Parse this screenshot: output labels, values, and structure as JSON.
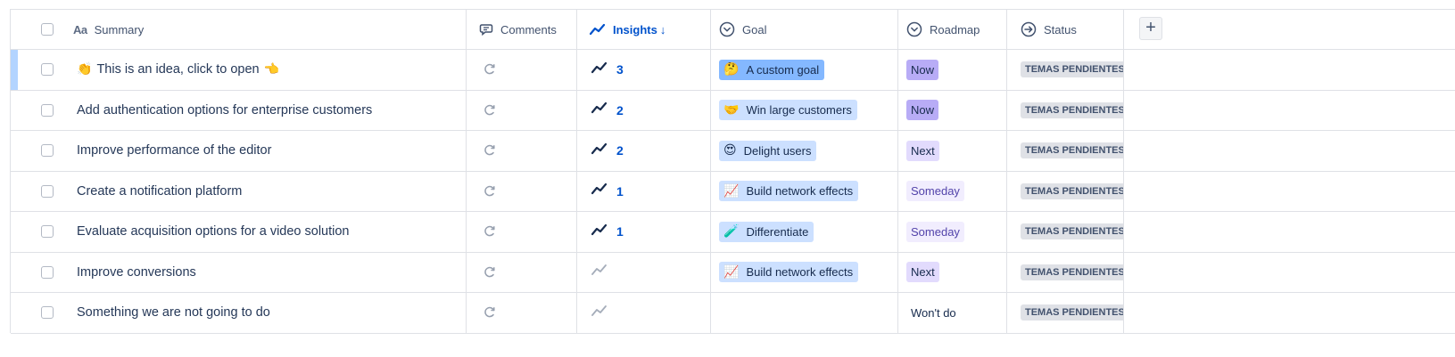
{
  "header": {
    "summary": "Summary",
    "comments": "Comments",
    "insights": "Insights",
    "goal": "Goal",
    "roadmap": "Roadmap",
    "status": "Status",
    "add_column": "+"
  },
  "roadmap_colors": {
    "Now": {
      "bg": "#b8acf6",
      "fg": "#172b4d"
    },
    "Next": {
      "bg": "#e2dbfd",
      "fg": "#172b4d"
    },
    "Someday": {
      "bg": "#f1edfe",
      "fg": "#5243aa"
    }
  },
  "rows": [
    {
      "summary": "This is an idea, click to open",
      "emoji_left": "👏",
      "emoji_right": "👈",
      "insights": "3",
      "insight_active": true,
      "goal": {
        "emoji": "🤔",
        "label": "A custom goal",
        "strong": true
      },
      "roadmap": "Now",
      "status": "TEMAS PENDIENTES",
      "highlight": true
    },
    {
      "summary": "Add authentication options for enterprise customers",
      "insights": "2",
      "insight_active": true,
      "goal": {
        "emoji": "🤝",
        "label": "Win large customers"
      },
      "roadmap": "Now",
      "status": "TEMAS PENDIENTES"
    },
    {
      "summary": "Improve performance of the editor",
      "insights": "2",
      "insight_active": true,
      "goal": {
        "emoji": "😍",
        "label": "Delight users"
      },
      "roadmap": "Next",
      "status": "TEMAS PENDIENTES"
    },
    {
      "summary": "Create a notification platform",
      "insights": "1",
      "insight_active": true,
      "goal": {
        "emoji": "📈",
        "label": "Build network effects"
      },
      "roadmap": "Someday",
      "status": "TEMAS PENDIENTES"
    },
    {
      "summary": "Evaluate acquisition options for a video solution",
      "insights": "1",
      "insight_active": true,
      "goal": {
        "emoji": "🧪",
        "label": "Differentiate"
      },
      "roadmap": "Someday",
      "status": "TEMAS PENDIENTES"
    },
    {
      "summary": "Improve conversions",
      "insights": "",
      "insight_active": false,
      "goal": {
        "emoji": "📈",
        "label": "Build network effects"
      },
      "roadmap": "Next",
      "status": "TEMAS PENDIENTES"
    },
    {
      "summary": "Something we are not going to do",
      "insights": "",
      "insight_active": false,
      "goal": null,
      "roadmap": "Won't do",
      "roadmap_plain": true,
      "status": "TEMAS PENDIENTES"
    }
  ]
}
